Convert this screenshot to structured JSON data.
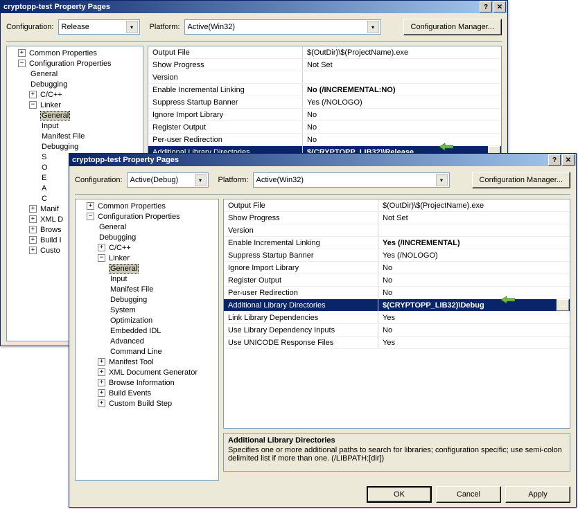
{
  "back": {
    "title": "cryptopp-test Property Pages",
    "config_label": "Configuration:",
    "config_value": "Release",
    "platform_label": "Platform:",
    "platform_value": "Active(Win32)",
    "cfgmgr": "Configuration Manager...",
    "tree": {
      "common": "Common Properties",
      "confprops": "Configuration Properties",
      "general": "General",
      "debugging": "Debugging",
      "ccpp": "C/C++",
      "linker": "Linker",
      "l_general": "General",
      "l_input": "Input",
      "l_manifest": "Manifest File",
      "l_debugging": "Debugging",
      "l_s": "S",
      "l_o": "O",
      "l_e": "E",
      "l_a": "A",
      "l_c": "C",
      "manif": "Manif",
      "xmld": "XML D",
      "brows": "Brows",
      "buildi": "Build I",
      "custo": "Custo"
    },
    "rows": [
      {
        "name": "Output File",
        "val": "$(OutDir)\\$(ProjectName).exe"
      },
      {
        "name": "Show Progress",
        "val": "Not Set"
      },
      {
        "name": "Version",
        "val": ""
      },
      {
        "name": "Enable Incremental Linking",
        "val": "No (/INCREMENTAL:NO)",
        "bold": true
      },
      {
        "name": "Suppress Startup Banner",
        "val": "Yes (/NOLOGO)"
      },
      {
        "name": "Ignore Import Library",
        "val": "No"
      },
      {
        "name": "Register Output",
        "val": "No"
      },
      {
        "name": "Per-user Redirection",
        "val": "No"
      },
      {
        "name": "Additional Library Directories",
        "val": "$(CRYPTOPP_LIB32)\\Release",
        "hl": true
      }
    ]
  },
  "front": {
    "title": "cryptopp-test Property Pages",
    "config_label": "Configuration:",
    "config_value": "Active(Debug)",
    "platform_label": "Platform:",
    "platform_value": "Active(Win32)",
    "cfgmgr": "Configuration Manager...",
    "tree": {
      "common": "Common Properties",
      "confprops": "Configuration Properties",
      "general": "General",
      "debugging": "Debugging",
      "ccpp": "C/C++",
      "linker": "Linker",
      "l_general": "General",
      "l_input": "Input",
      "l_manifest": "Manifest File",
      "l_debugging": "Debugging",
      "l_system": "System",
      "l_opt": "Optimization",
      "l_eidl": "Embedded IDL",
      "l_adv": "Advanced",
      "l_cmd": "Command Line",
      "manif": "Manifest Tool",
      "xmld": "XML Document Generator",
      "brows": "Browse Information",
      "build": "Build Events",
      "custo": "Custom Build Step"
    },
    "rows": [
      {
        "name": "Output File",
        "val": "$(OutDir)\\$(ProjectName).exe"
      },
      {
        "name": "Show Progress",
        "val": "Not Set"
      },
      {
        "name": "Version",
        "val": ""
      },
      {
        "name": "Enable Incremental Linking",
        "val": "Yes (/INCREMENTAL)",
        "bold": true
      },
      {
        "name": "Suppress Startup Banner",
        "val": "Yes (/NOLOGO)"
      },
      {
        "name": "Ignore Import Library",
        "val": "No"
      },
      {
        "name": "Register Output",
        "val": "No"
      },
      {
        "name": "Per-user Redirection",
        "val": "No"
      },
      {
        "name": "Additional Library Directories",
        "val": "$(CRYPTOPP_LIB32)\\Debug",
        "hl": true
      },
      {
        "name": "Link Library Dependencies",
        "val": "Yes"
      },
      {
        "name": "Use Library Dependency Inputs",
        "val": "No"
      },
      {
        "name": "Use UNICODE Response Files",
        "val": "Yes"
      }
    ],
    "desc_title": "Additional Library Directories",
    "desc_body": "Specifies one or more additional paths to search for libraries; configuration specific; use semi-colon delimited list if more than one.     (/LIBPATH:[dir])",
    "ok": "OK",
    "cancel": "Cancel",
    "apply": "Apply"
  }
}
